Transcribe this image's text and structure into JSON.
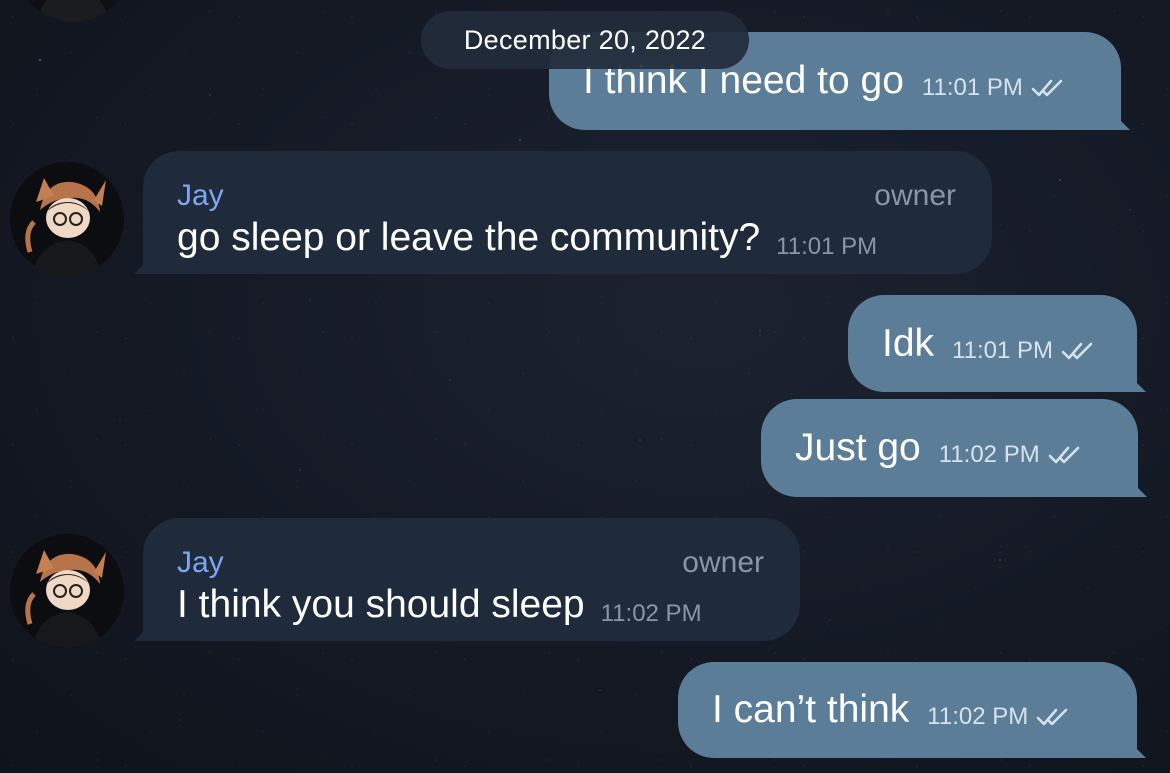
{
  "chat": {
    "date_separator": "December 20, 2022",
    "messages": [
      {
        "direction": "out",
        "text": "I think I need to go",
        "time": "11:01 PM",
        "status": "read"
      },
      {
        "direction": "in",
        "sender": "Jay",
        "role": "owner",
        "text": "go sleep or leave the community?",
        "time": "11:01 PM"
      },
      {
        "direction": "out",
        "text": "Idk",
        "time": "11:01 PM",
        "status": "read"
      },
      {
        "direction": "out",
        "text": "Just go",
        "time": "11:02 PM",
        "status": "read"
      },
      {
        "direction": "in",
        "sender": "Jay",
        "role": "owner",
        "text": "I think you should sleep",
        "time": "11:02 PM"
      },
      {
        "direction": "out",
        "text": "I can’t think",
        "time": "11:02 PM",
        "status": "read"
      }
    ]
  },
  "colors": {
    "outgoing_bubble": "#5b7d97",
    "incoming_bubble": "#1f2a3a",
    "sender_name": "#7ea6f3",
    "background": "#141924"
  },
  "icons": {
    "read_status": "double-check-icon",
    "avatar": "user-avatar-illustration"
  }
}
